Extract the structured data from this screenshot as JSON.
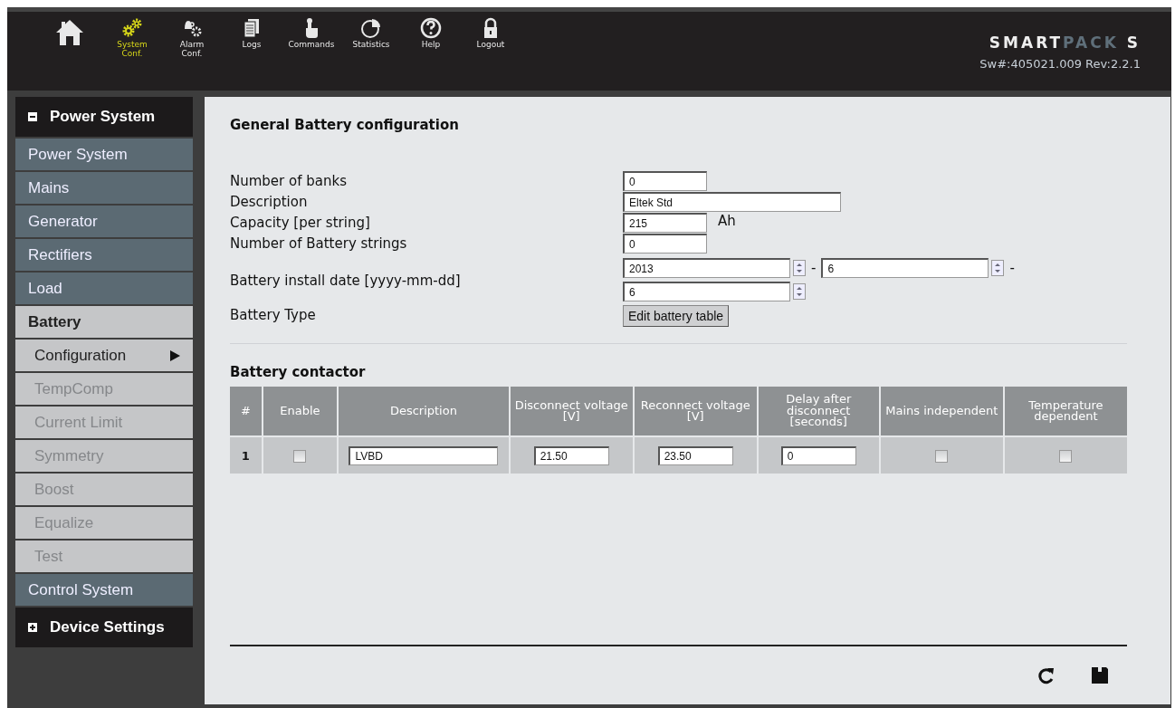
{
  "nav": [
    {
      "selected": false
    },
    {
      "label": "System Conf.",
      "selected": true
    },
    {
      "label": "Alarm Conf.",
      "selected": false
    },
    {
      "label": "Logs",
      "selected": false
    },
    {
      "label": "Commands",
      "selected": false
    },
    {
      "label": "Statistics",
      "selected": false
    },
    {
      "label": "Help",
      "selected": false
    },
    {
      "label": "Logout",
      "selected": false
    }
  ],
  "logo": {
    "primary": "SMART",
    "secondary": "PACK",
    "suffix": "S"
  },
  "version": "Sw#:405021.009 Rev:2.2.1",
  "sidebar": [
    {
      "label": "Power System",
      "expanded": true,
      "items": [
        {
          "label": "Power System",
          "kind": "page",
          "selected": false,
          "disabled": false
        },
        {
          "label": "Mains",
          "kind": "page",
          "selected": false,
          "disabled": false
        },
        {
          "label": "Generator",
          "kind": "page",
          "selected": false,
          "disabled": false
        },
        {
          "label": "Rectifiers",
          "kind": "page",
          "selected": false,
          "disabled": false
        },
        {
          "label": "Load",
          "kind": "page",
          "selected": false,
          "disabled": false
        },
        {
          "label": "Battery",
          "kind": "page",
          "selected": true,
          "disabled": false
        },
        {
          "label": "Configuration",
          "kind": "sub",
          "selected": true,
          "disabled": false
        },
        {
          "label": "TempComp",
          "kind": "sub",
          "selected": false,
          "disabled": true
        },
        {
          "label": "Current Limit",
          "kind": "sub",
          "selected": false,
          "disabled": true
        },
        {
          "label": "Symmetry",
          "kind": "sub",
          "selected": false,
          "disabled": true
        },
        {
          "label": "Boost",
          "kind": "sub",
          "selected": false,
          "disabled": true
        },
        {
          "label": "Equalize",
          "kind": "sub",
          "selected": false,
          "disabled": true
        },
        {
          "label": "Test",
          "kind": "sub",
          "selected": false,
          "disabled": true
        },
        {
          "label": "Control System",
          "kind": "page",
          "selected": false,
          "disabled": false
        }
      ]
    },
    {
      "label": "Device Settings",
      "expanded": false
    }
  ],
  "general": {
    "title": "General Battery configuration",
    "fields": [
      {
        "kind": "text",
        "label": "Number of banks",
        "value": "0"
      },
      {
        "kind": "text",
        "label": "Description",
        "value": "Eltek Std"
      },
      {
        "kind": "text",
        "label": "Capacity [per string]",
        "value": "215",
        "unit": "Ah"
      },
      {
        "kind": "text",
        "label": "Number of Battery strings",
        "value": "0"
      },
      {
        "kind": "date",
        "label": "Battery install date [yyyy-mm-dd]",
        "values": [
          "2013",
          "6",
          "6"
        ],
        "separator": "-"
      },
      {
        "kind": "button",
        "label": "Battery Type",
        "button": "Edit battery table"
      }
    ]
  },
  "contactor": {
    "title": "Battery contactor",
    "columns": [
      "#",
      "Enable",
      "Description",
      "Disconnect voltage [V]",
      "Reconnect voltage [V]",
      "Delay after disconnect [seconds]",
      "Mains independent",
      "Temperature dependent"
    ],
    "rows": [
      {
        "index": "1",
        "enabled": false,
        "description": "LVBD",
        "disconnect": "21.50",
        "reconnect": "23.50",
        "delay": "0",
        "mains_independent": false,
        "temperature_dependent": false
      }
    ]
  }
}
